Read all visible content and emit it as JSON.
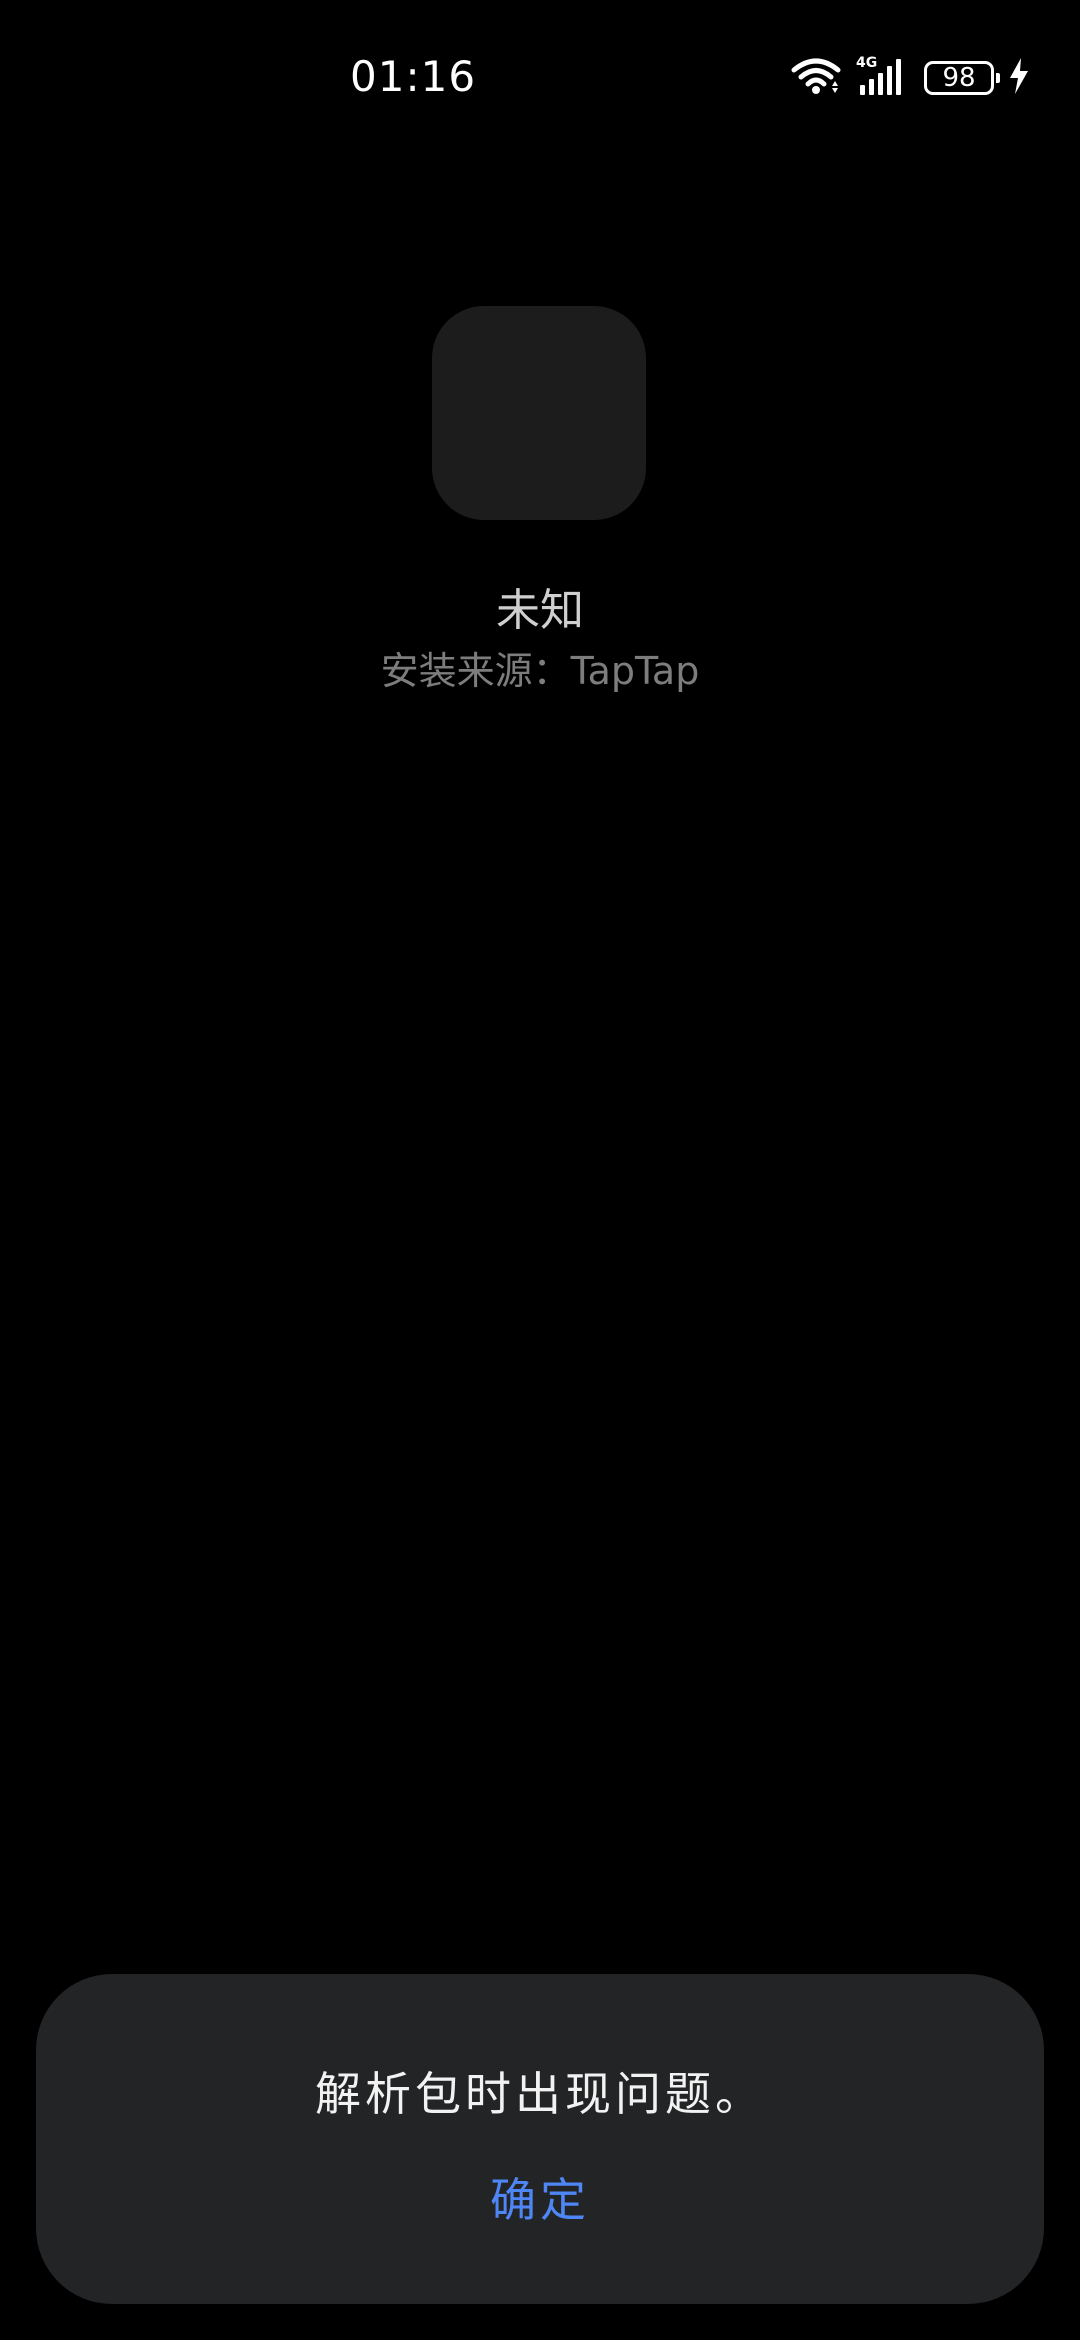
{
  "status_bar": {
    "time": "01:16",
    "network": "4G",
    "battery_level": "98",
    "icons": [
      "wifi-icon",
      "signal-4g-icon",
      "battery-icon",
      "charging-bolt-icon"
    ],
    "color": "#ffffff"
  },
  "app": {
    "icon": "app-placeholder-icon",
    "icon_color": "#1c1c1c",
    "name": "未知",
    "install_source": "安装来源：TapTap"
  },
  "dialog": {
    "message": "解析包时出现问题。",
    "confirm_label": "确定",
    "background": "#232425",
    "accent": "#4f86f5"
  }
}
